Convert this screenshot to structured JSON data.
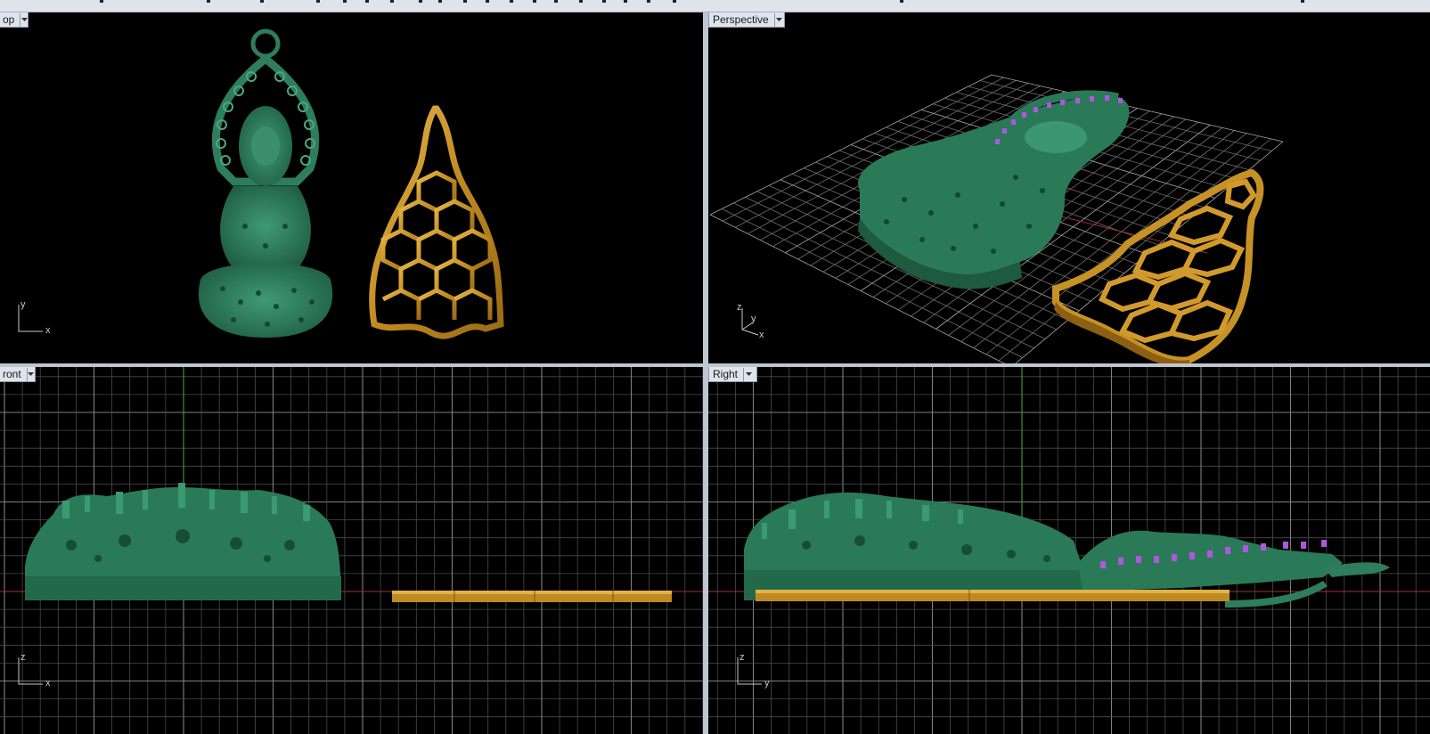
{
  "window": {
    "toolbar_strip": ""
  },
  "viewports": {
    "top": {
      "label": "Top",
      "visible_label": "op",
      "axes": {
        "a": "y",
        "b": "x"
      }
    },
    "perspective": {
      "label": "Perspective",
      "axes": {
        "a": "z",
        "b": "y",
        "c": "x"
      }
    },
    "front": {
      "label": "Front",
      "visible_label": "ront",
      "axes": {
        "a": "z",
        "b": "x"
      }
    },
    "right": {
      "label": "Right",
      "axes": {
        "a": "z",
        "b": "y"
      }
    }
  },
  "colors": {
    "viewport_bg": "#000000",
    "grid": "#5a5a5a",
    "grid_major": "#8a8a8a",
    "axis_x": "#b03030",
    "axis_y": "#2f8f2f",
    "pendant_green": "#2e7d5e",
    "gold": "#c79428",
    "purple": "#a04ad0",
    "label_bg": "#dfe4ec"
  },
  "icons": {
    "viewport_menu": "chevron-down-icon"
  }
}
